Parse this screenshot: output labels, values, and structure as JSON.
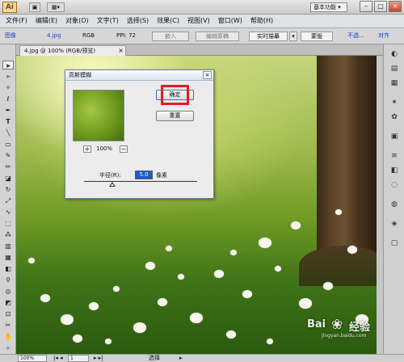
{
  "app": {
    "logo": "Ai",
    "workspace": "基本功能",
    "window_buttons": [
      "–",
      "□",
      "×"
    ]
  },
  "menu": [
    "文件(F)",
    "编辑(E)",
    "对象(O)",
    "文字(T)",
    "选择(S)",
    "效果(C)",
    "视图(V)",
    "窗口(W)",
    "帮助(H)"
  ],
  "control": {
    "item_type": "图像",
    "link": "4.jpg",
    "color_mode": "RGB",
    "ppi": "PPI: 72",
    "embed": "嵌入",
    "edit_original": "编辑原稿",
    "trace": "实时描摹",
    "mask": "蒙版",
    "opacity": "不透...",
    "align": "对齐"
  },
  "doc_tab": {
    "title": "4.jpg @ 100% (RGB/预览)",
    "close": "×"
  },
  "dialog": {
    "title": "高斯模糊",
    "close": "×",
    "ok": "确定",
    "reset": "重置",
    "zoom": "100%",
    "zoom_in": "+",
    "zoom_out": "−",
    "radius_label": "半径(R):",
    "radius_value": "5.0",
    "radius_unit": "像素",
    "radius_slider_fraction": 0.25
  },
  "status": {
    "zoom": "100%",
    "page": "1",
    "mode": "选择"
  },
  "watermark": {
    "text_left": "Bai",
    "text_right": "经验",
    "sub": "jingyan.baidu.com"
  },
  "colors": {
    "accent": "#1f5ccc",
    "highlight": "#e51d1d"
  },
  "icons": {
    "tools": [
      "selection-arrow-icon",
      "direct-select-icon",
      "magic-wand-icon",
      "lasso-icon",
      "pen-icon",
      "type-icon",
      "line-icon",
      "rectangle-icon",
      "paintbrush-icon",
      "pencil-icon",
      "eraser-icon",
      "rotate-icon",
      "scale-icon",
      "warp-icon",
      "free-transform-icon",
      "symbol-sprayer-icon",
      "column-graph-icon",
      "mesh-icon",
      "gradient-icon",
      "eyedropper-icon",
      "blend-icon",
      "live-paint-icon",
      "slice-icon",
      "scissors-icon",
      "hand-icon",
      "zoom-icon"
    ]
  }
}
